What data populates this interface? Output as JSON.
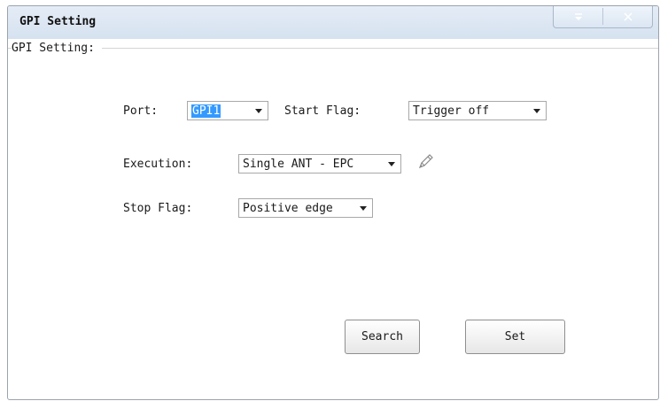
{
  "window": {
    "title": "GPI Setting",
    "buttons": {
      "menu_icon": "dropdown-menu-icon",
      "close_icon": "close-icon"
    }
  },
  "group": {
    "label": "GPI Setting:"
  },
  "form": {
    "port_label": "Port:",
    "port_value": "GPI1",
    "start_flag_label": "Start Flag:",
    "start_flag_value": "Trigger off",
    "execution_label": "Execution:",
    "execution_value": "Single ANT - EPC",
    "stop_flag_label": "Stop Flag:",
    "stop_flag_value": "Positive edge"
  },
  "actions": {
    "search_label": "Search",
    "set_label": "Set"
  },
  "colors": {
    "title_bar": "#dbe6f3",
    "selection": "#3399ff",
    "border": "#9aa3ad"
  }
}
